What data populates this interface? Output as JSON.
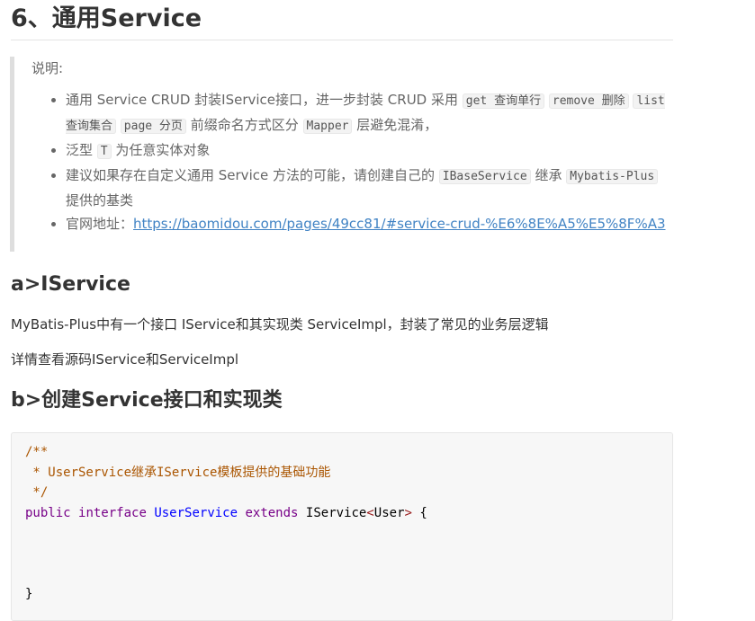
{
  "section_title": "6、通用Service",
  "note": {
    "title": "说明:",
    "bullet1": {
      "text1": "通用 Service CRUD 封装IService接口，进一步封装 CRUD 采用",
      "code1": "get 查询单行",
      "code2": "remove 删除",
      "code3": "list 查询集合",
      "code4": "page 分页",
      "text2": "前缀命名方式区分",
      "code5": "Mapper",
      "text3": "层避免混淆，"
    },
    "bullet2": {
      "text1": "泛型",
      "code1": "T",
      "text2": "为任意实体对象"
    },
    "bullet3": {
      "text1": "建议如果存在自定义通用 Service 方法的可能，请创建自己的",
      "code1": "IBaseService",
      "text2": "继承",
      "code2": "Mybatis-Plus",
      "text3": "提供的基类"
    },
    "bullet4": {
      "label": "官网地址：",
      "link": "https://baomidou.com/pages/49cc81/#service-crud-%E6%8E%A5%E5%8F%A3"
    }
  },
  "subsection_a": {
    "title": "a>IService",
    "para1": "MyBatis-Plus中有一个接口 IService和其实现类 ServiceImpl，封装了常见的业务层逻辑",
    "para2": "详情查看源码IService和ServiceImpl"
  },
  "subsection_b": {
    "title": "b>创建Service接口和实现类"
  },
  "code": {
    "comment_open": "/**",
    "comment_line": " * UserService继承IService模板提供的基础功能",
    "comment_close": " */",
    "kw_public": "public",
    "kw_interface": "interface",
    "name": "UserService",
    "kw_extends": "extends",
    "parent": "IService",
    "lt": "<",
    "generic": "User",
    "gt": ">",
    "open_brace": "{",
    "close_brace": "}"
  },
  "colors": {
    "link": "#4183c4",
    "comment": "#aa5500",
    "keyword": "#770088",
    "type": "#0000ff"
  }
}
